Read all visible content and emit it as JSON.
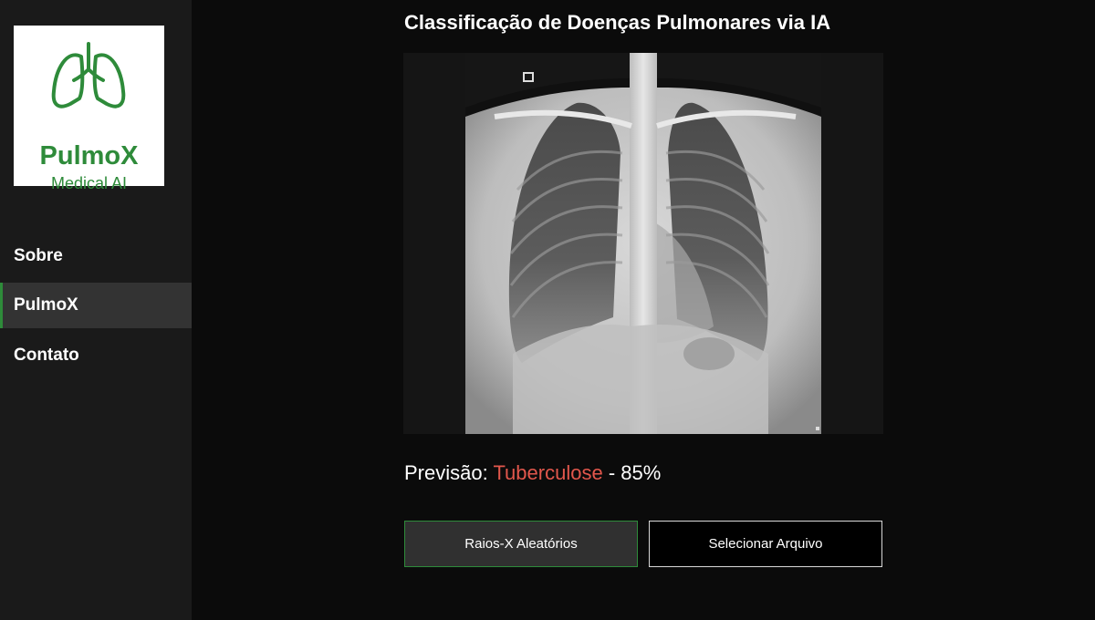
{
  "brand": {
    "name": "PulmoX",
    "subtitle": "Medical AI",
    "logo_icon": "lungs-icon",
    "color": "#2e8b3a"
  },
  "sidebar": {
    "items": [
      {
        "label": "Sobre",
        "active": false
      },
      {
        "label": "PulmoX",
        "active": true
      },
      {
        "label": "Contato",
        "active": false
      }
    ]
  },
  "main": {
    "title": "Classificação de Doenças Pulmonares via IA",
    "image_content": "chest-xray",
    "prediction": {
      "label": "Previsão:",
      "disease": "Tuberculose",
      "separator": "-",
      "confidence": "85%",
      "disease_color": "#e2574c"
    },
    "buttons": {
      "random": "Raios-X Aleatórios",
      "select_file": "Selecionar Arquivo"
    }
  }
}
